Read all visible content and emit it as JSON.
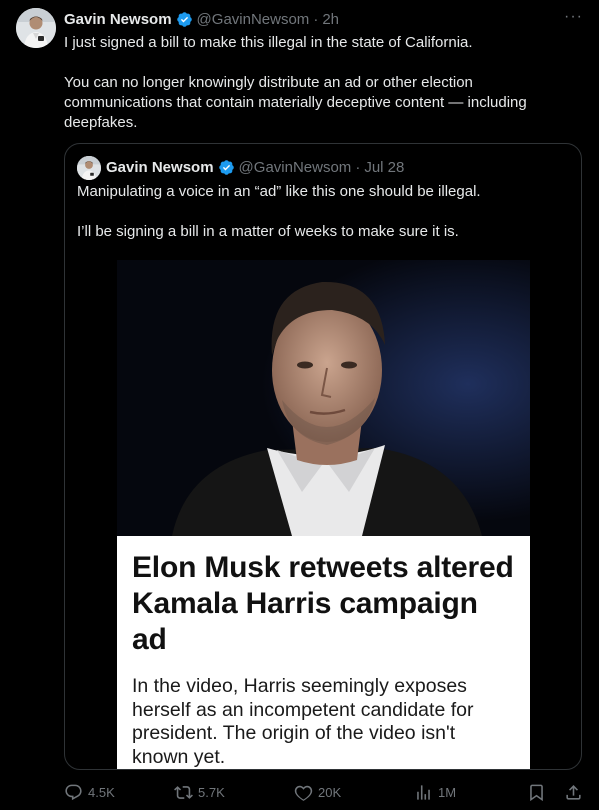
{
  "tweet": {
    "author_name": "Gavin Newsom",
    "handle": "@GavinNewsom",
    "separator": "·",
    "time": "2h",
    "more_label": "···",
    "text_lines": [
      "I just signed a bill to make this illegal in the state of California.",
      "You can no longer knowingly distribute an ad or other election communications that contain materially deceptive content — including deepfakes."
    ]
  },
  "quoted_tweet": {
    "author_name": "Gavin Newsom",
    "handle": "@GavinNewsom",
    "separator": "·",
    "time": "Jul 28",
    "text_lines": [
      "Manipulating a voice in an “ad” like this one should be illegal.",
      "I’ll be signing a bill in a matter of weeks to make sure it is."
    ],
    "media_card": {
      "headline": "Elon Musk retweets altered Kamala Harris campaign ad",
      "subhead": "In the video, Harris seemingly exposes herself as an incompetent candidate for president. The origin of the video isn't known yet."
    }
  },
  "actions": {
    "replies": "4.5K",
    "retweets": "5.7K",
    "likes": "20K",
    "views": "1M"
  },
  "icons": [
    "verified-badge-icon",
    "more-icon",
    "reply-icon",
    "retweet-icon",
    "like-icon",
    "views-icon",
    "bookmark-icon",
    "share-icon"
  ],
  "colors": {
    "background": "#000000",
    "text_primary": "#e7e9ea",
    "text_secondary": "#71767b",
    "verified_blue": "#1d9bf0",
    "border": "#2f3336"
  }
}
